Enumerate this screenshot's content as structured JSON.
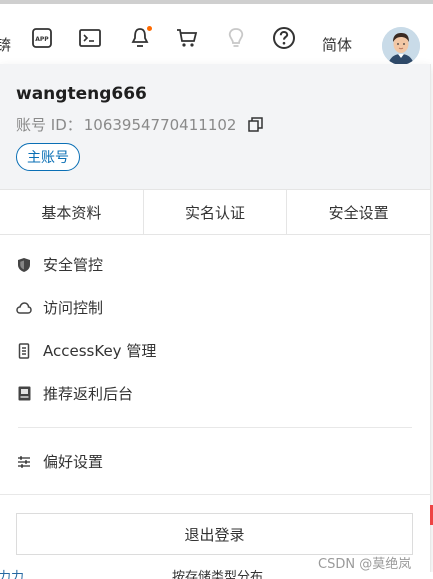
{
  "topbar": {
    "left_partial_text": "锛",
    "lang_label": "简体",
    "icons": [
      "app-icon",
      "terminal-icon",
      "bell-icon",
      "cart-icon",
      "lightbulb-icon",
      "help-icon"
    ],
    "accent": "#ff6a00"
  },
  "profile": {
    "username": "wangteng666",
    "account_id_label": "账号 ID：",
    "account_id": "1063954770411102",
    "badge": "主账号"
  },
  "tabs": [
    "基本资料",
    "实名认证",
    "安全设置"
  ],
  "menu": [
    {
      "label": "安全管控",
      "icon": "shield-icon"
    },
    {
      "label": "访问控制",
      "icon": "cloud-icon"
    },
    {
      "label": "AccessKey 管理",
      "icon": "key-icon"
    },
    {
      "label": "推荐返利后台",
      "icon": "card-icon"
    }
  ],
  "preferences": {
    "label": "偏好设置",
    "icon": "sliders-icon"
  },
  "logout_label": "退出登录",
  "watermark": "CSDN @莫绝岚",
  "bottom_partial": {
    "left": "力力",
    "mid": "按存储类型分布"
  }
}
